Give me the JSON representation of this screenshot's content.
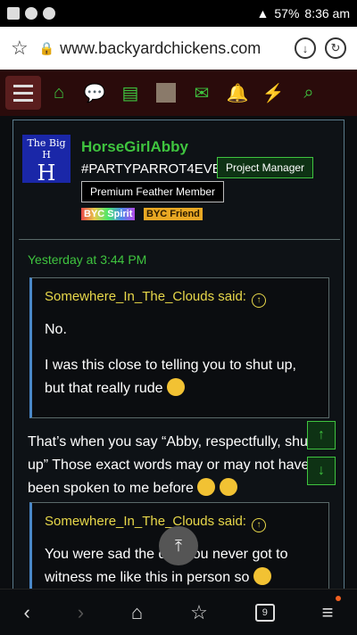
{
  "status": {
    "battery": "57%",
    "time": "8:36 am"
  },
  "browser": {
    "url": "www.backyardchickens.com",
    "tab_count": "9"
  },
  "post": {
    "avatar_text": "The Big H",
    "username": "HorseGirlAbby",
    "user_title": "#PARTYPARROT4EVER",
    "badge_role": "Project Manager",
    "badge_member": "Premium Feather Member",
    "mini_spirit": "BYC Spirit",
    "mini_friend": "BYC Friend",
    "timestamp": "Yesterday at 3:44 PM",
    "quote1": {
      "author": "Somewhere_In_The_Clouds said:",
      "line1": "No.",
      "line2": "I was this close to telling you to shut up, but that really rude"
    },
    "body": "That’s when you say “Abby, respectfully, shut up” Those exact words may or may not have been spoken to me before",
    "quote2": {
      "author": "Somewhere_In_The_Clouds said:",
      "text": "You were sad the day you never got to witness me like this in person so"
    }
  },
  "colors": {
    "accent": "#3fc43f",
    "quote_author": "#e8d84a",
    "navbar": "#2a0b0b"
  }
}
